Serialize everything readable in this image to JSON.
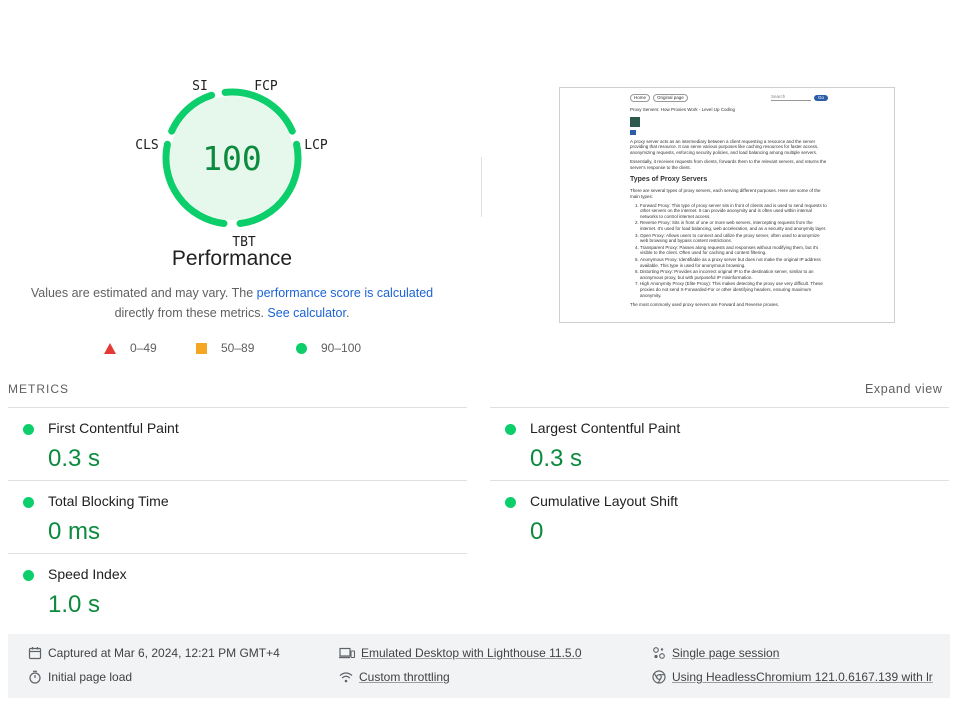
{
  "gauge": {
    "score": "100",
    "title": "Performance",
    "labels": {
      "si": "SI",
      "fcp": "FCP",
      "lcp": "LCP",
      "tbt": "TBT",
      "cls": "CLS"
    },
    "color": "#0cce6b",
    "fill": "#e6f7ec"
  },
  "score_desc": {
    "text1": "Values are estimated and may vary. The ",
    "link1": "performance score is calculated",
    "text2": "directly from these metrics. ",
    "link2": "See calculator",
    "text3": "."
  },
  "legend": {
    "fail": "0–49",
    "average": "50–89",
    "pass": "90–100"
  },
  "screenshot": {
    "nav": {
      "home": "Home",
      "original": "Original page",
      "search_placeholder": "Search",
      "go": "Go"
    },
    "breadcrumb": "Proxy Servers: How Proxies Work - Level Up Coding",
    "intro1": "A proxy server acts as an intermediary between a client requesting a resource and the server providing that resource. It can serve various purposes like caching resources for faster access, anonymizing requests, enforcing security policies, and load balancing among multiple servers.",
    "intro2": "Essentially, it receives requests from clients, forwards them to the relevant servers, and returns the server's response to the client.",
    "heading": "Types of Proxy Servers",
    "lead": "There are several types of proxy servers, each serving different purposes. Here are some of the main types:",
    "items": [
      "Forward Proxy: This type of proxy server sits in front of clients and is used to send requests to other servers on the internet. It can provide anonymity and is often used within internal networks to control internet access.",
      "Reverse Proxy: Sits in front of one or more web servers, intercepting requests from the internet. It's used for load balancing, web acceleration, and as a security and anonymity layer.",
      "Open Proxy: Allows users to connect and utilize the proxy server, often used to anonymize web browsing and bypass content restrictions.",
      "Transparent Proxy: Passes along requests and responses without modifying them, but it's visible to the client. Often used for caching and content filtering.",
      "Anonymous Proxy: Identifiable as a proxy server but does not make the original IP address available. This type is used for anonymous browsing.",
      "Distorting Proxy: Provides an incorrect original IP to the destination server, similar to an anonymous proxy, but with purposeful IP misinformation.",
      "High Anonymity Proxy (Elite Proxy): This makes detecting the proxy use very difficult. These proxies do not send X-Forwarded-For or other identifying headers, ensuring maximum anonymity."
    ],
    "tail": "The most commonly used proxy servers are Forward and Reverse proxies."
  },
  "metrics": {
    "heading": "METRICS",
    "expand": "Expand view",
    "fcp": {
      "title": "First Contentful Paint",
      "value": "0.3 s"
    },
    "lcp": {
      "title": "Largest Contentful Paint",
      "value": "0.3 s"
    },
    "tbt": {
      "title": "Total Blocking Time",
      "value": "0 ms"
    },
    "cls": {
      "title": "Cumulative Layout Shift",
      "value": "0"
    },
    "si": {
      "title": "Speed Index",
      "value": "1.0 s"
    },
    "pass_color": "#0cce6b",
    "value_color": "#0c8a3d"
  },
  "runtime": {
    "captured": "Captured at Mar 6, 2024, 12:21 PM GMT+4",
    "emulated": "Emulated Desktop with Lighthouse 11.5.0",
    "session": "Single page session",
    "initial": "Initial page load",
    "throttle": "Custom throttling",
    "browser": "Using HeadlessChromium 121.0.6167.139 with lr"
  }
}
